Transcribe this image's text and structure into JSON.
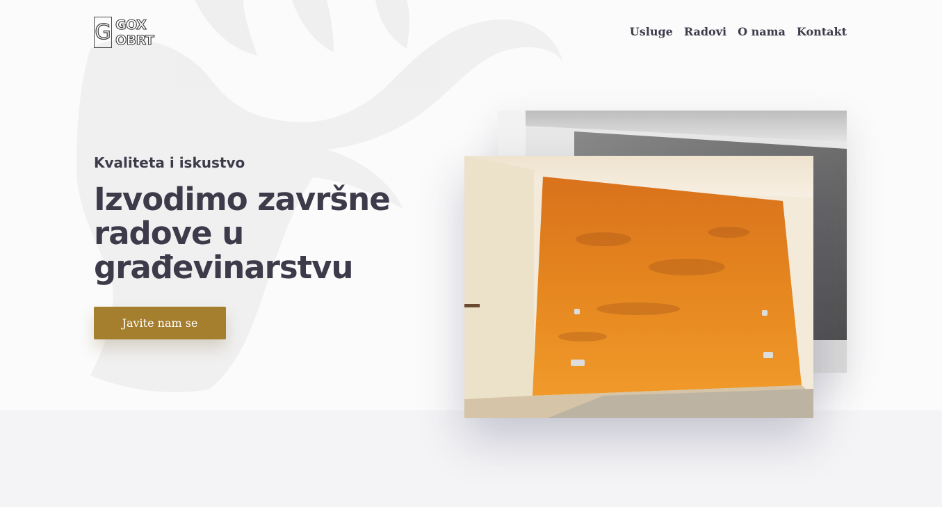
{
  "brand": {
    "logo_mark": "G",
    "logo_line1": "GOX",
    "logo_line2": "OBRT"
  },
  "nav": {
    "items": [
      {
        "label": "Usluge"
      },
      {
        "label": "Radovi"
      },
      {
        "label": "O nama"
      },
      {
        "label": "Kontakt"
      }
    ]
  },
  "hero": {
    "eyebrow": "Kvaliteta i iskustvo",
    "headline": "Izvodimo završne radove u građevinarstvu",
    "cta_label": "Javite nam se"
  },
  "colors": {
    "accent": "#a57e2e",
    "text": "#3d3a4a",
    "background": "#fbfbfb"
  },
  "images": {
    "back_photo": "gray-wall-photo",
    "front_photo": "orange-wall-photo"
  }
}
